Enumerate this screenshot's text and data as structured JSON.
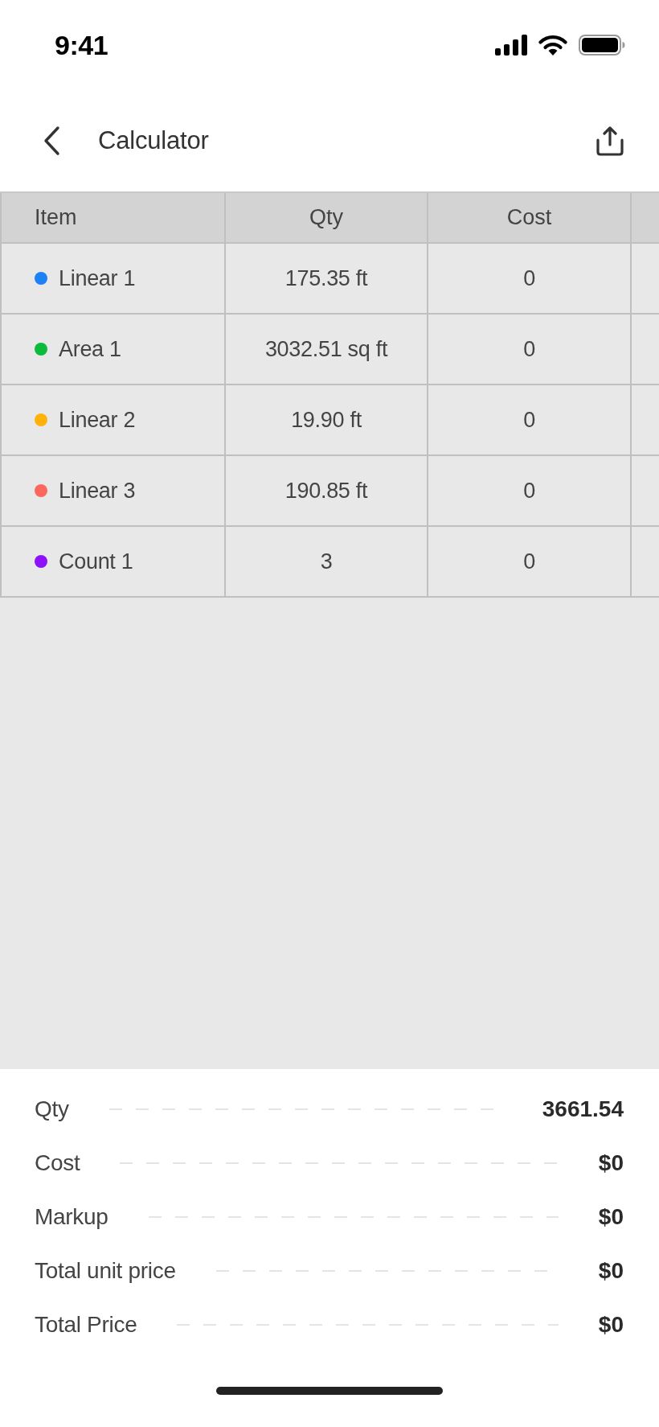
{
  "status_bar": {
    "time": "9:41"
  },
  "nav": {
    "title": "Calculator"
  },
  "table": {
    "columns": [
      "Item",
      "Qty",
      "Cost"
    ],
    "rows": [
      {
        "item": "Linear 1",
        "color": "#1e80f5",
        "qty": "175.35 ft",
        "cost": "0"
      },
      {
        "item": "Area 1",
        "color": "#0cba3c",
        "qty": "3032.51 sq ft",
        "cost": "0"
      },
      {
        "item": "Linear 2",
        "color": "#ffb20a",
        "qty": "19.90 ft",
        "cost": "0"
      },
      {
        "item": "Linear 3",
        "color": "#fe675d",
        "qty": "190.85 ft",
        "cost": "0"
      },
      {
        "item": "Count 1",
        "color": "#8d12fa",
        "qty": "3",
        "cost": "0"
      }
    ]
  },
  "summary": [
    {
      "label": "Qty",
      "value": "3661.54"
    },
    {
      "label": "Cost",
      "value": "$0"
    },
    {
      "label": "Markup",
      "value": "$0"
    },
    {
      "label": "Total unit price",
      "value": "$0"
    },
    {
      "label": "Total Price",
      "value": "$0"
    }
  ]
}
